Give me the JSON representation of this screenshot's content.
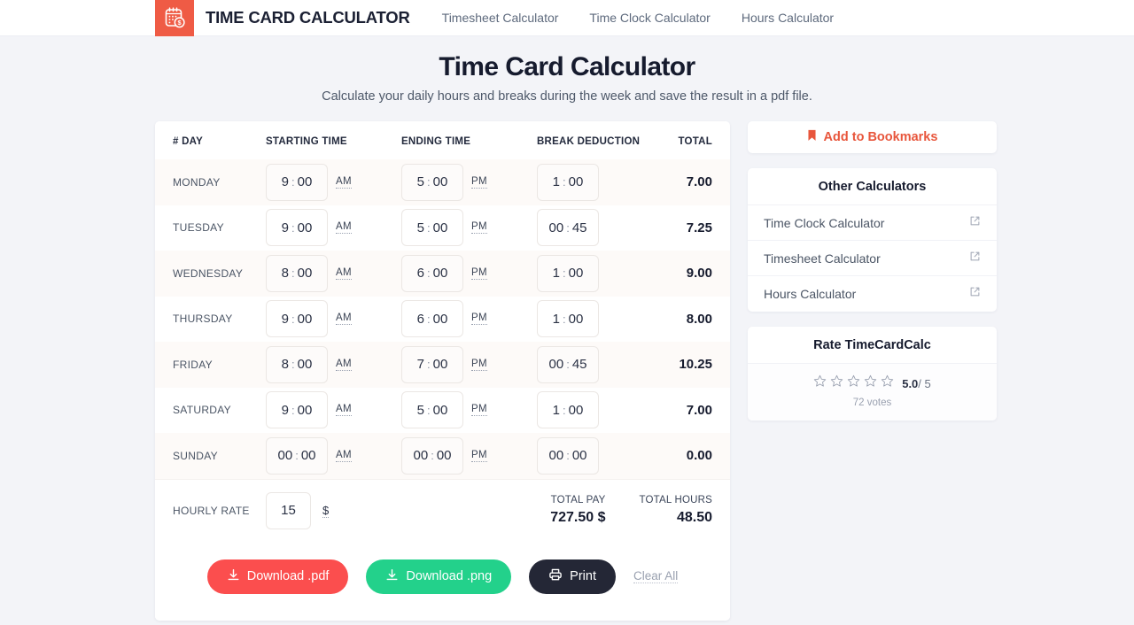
{
  "header": {
    "brand_name": "TIME CARD CALCULATOR",
    "logo_icon": "calendar-dollar-icon",
    "nav": [
      {
        "label": "Timesheet Calculator"
      },
      {
        "label": "Time Clock Calculator"
      },
      {
        "label": "Hours Calculator"
      }
    ]
  },
  "page": {
    "title": "Time Card Calculator",
    "subtitle": "Calculate your daily hours and breaks during the week and save the result in a pdf file."
  },
  "table": {
    "headers": {
      "day": "# DAY",
      "start": "STARTING TIME",
      "end": "ENDING TIME",
      "break": "BREAK DEDUCTION",
      "total": "TOTAL"
    },
    "rows": [
      {
        "day": "MONDAY",
        "start_h": "9",
        "start_m": "00",
        "start_mer": "AM",
        "end_h": "5",
        "end_m": "00",
        "end_mer": "PM",
        "break_h": "1",
        "break_m": "00",
        "total": "7.00"
      },
      {
        "day": "TUESDAY",
        "start_h": "9",
        "start_m": "00",
        "start_mer": "AM",
        "end_h": "5",
        "end_m": "00",
        "end_mer": "PM",
        "break_h": "00",
        "break_m": "45",
        "total": "7.25"
      },
      {
        "day": "WEDNESDAY",
        "start_h": "8",
        "start_m": "00",
        "start_mer": "AM",
        "end_h": "6",
        "end_m": "00",
        "end_mer": "PM",
        "break_h": "1",
        "break_m": "00",
        "total": "9.00"
      },
      {
        "day": "THURSDAY",
        "start_h": "9",
        "start_m": "00",
        "start_mer": "AM",
        "end_h": "6",
        "end_m": "00",
        "end_mer": "PM",
        "break_h": "1",
        "break_m": "00",
        "total": "8.00"
      },
      {
        "day": "FRIDAY",
        "start_h": "8",
        "start_m": "00",
        "start_mer": "AM",
        "end_h": "7",
        "end_m": "00",
        "end_mer": "PM",
        "break_h": "00",
        "break_m": "45",
        "total": "10.25"
      },
      {
        "day": "SATURDAY",
        "start_h": "9",
        "start_m": "00",
        "start_mer": "AM",
        "end_h": "5",
        "end_m": "00",
        "end_mer": "PM",
        "break_h": "1",
        "break_m": "00",
        "total": "7.00"
      },
      {
        "day": "SUNDAY",
        "start_h": "00",
        "start_m": "00",
        "start_mer": "AM",
        "end_h": "00",
        "end_m": "00",
        "end_mer": "PM",
        "break_h": "00",
        "break_m": "00",
        "total": "0.00"
      }
    ],
    "separator": ":"
  },
  "footer": {
    "hourly_rate_label": "HOURLY RATE",
    "hourly_rate_value": "15",
    "currency_symbol": "$",
    "total_pay_label": "TOTAL PAY",
    "total_pay_value": "727.50 $",
    "total_hours_label": "TOTAL HOURS",
    "total_hours_value": "48.50"
  },
  "actions": {
    "download_pdf": "Download .pdf",
    "download_png": "Download .png",
    "print": "Print",
    "clear_all": "Clear All",
    "pdf_color": "#fb4e4e",
    "png_color": "#23d18b",
    "print_color": "#242736"
  },
  "sidebar": {
    "bookmark": {
      "label": "Add to Bookmarks",
      "icon": "bookmark-icon",
      "color": "#e8563c"
    },
    "other_calculators": {
      "title": "Other Calculators",
      "items": [
        {
          "label": "Time Clock Calculator",
          "icon": "external-link-icon"
        },
        {
          "label": "Timesheet Calculator",
          "icon": "external-link-icon"
        },
        {
          "label": "Hours Calculator",
          "icon": "external-link-icon"
        }
      ]
    },
    "rating": {
      "title": "Rate TimeCardCalc",
      "stars_filled": 0,
      "stars_total": 5,
      "score": "5.0",
      "out_of": "/ 5",
      "votes": "72 votes"
    }
  }
}
